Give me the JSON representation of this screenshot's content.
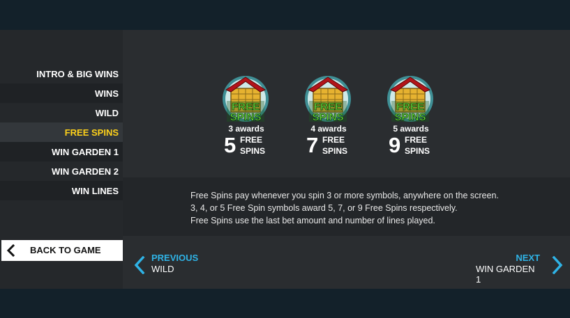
{
  "sidebar": {
    "items": [
      {
        "label": "INTRO & BIG WINS"
      },
      {
        "label": "WINS"
      },
      {
        "label": "WILD"
      },
      {
        "label": "FREE SPINS"
      },
      {
        "label": "WIN GARDEN 1"
      },
      {
        "label": "WIN GARDEN 2"
      },
      {
        "label": "WIN LINES"
      }
    ],
    "active_index": 3,
    "back_label": "BACK TO GAME"
  },
  "awards": [
    {
      "symbol_text_1": "FREE",
      "symbol_text_2": "SPINS",
      "awards_label": "3 awards",
      "count": "5",
      "unit_1": "FREE",
      "unit_2": "SPINS"
    },
    {
      "symbol_text_1": "FREE",
      "symbol_text_2": "SPINS",
      "awards_label": "4 awards",
      "count": "7",
      "unit_1": "FREE",
      "unit_2": "SPINS"
    },
    {
      "symbol_text_1": "FREE",
      "symbol_text_2": "SPINS",
      "awards_label": "5 awards",
      "count": "9",
      "unit_1": "FREE",
      "unit_2": "SPINS"
    }
  ],
  "description": [
    "Free Spins pay whenever you spin 3 or more symbols, anywhere on the screen.",
    "3, 4, or 5 Free Spin symbols award 5, 7, or 9 Free Spins respectively.",
    "Free Spins use the last bet amount and number of lines played."
  ],
  "pager": {
    "prev_title": "PREVIOUS",
    "prev_sub": "WILD",
    "next_title": "NEXT",
    "next_sub": "WIN GARDEN 1"
  },
  "colors": {
    "active": "#ffd21a",
    "accent": "#2fb3e6",
    "symbol_green": "#6fe03a",
    "symbol_red": "#b3141a"
  },
  "icons": {
    "back": "chevron-left-icon",
    "prev": "chevron-left-icon",
    "next": "chevron-right-icon"
  }
}
